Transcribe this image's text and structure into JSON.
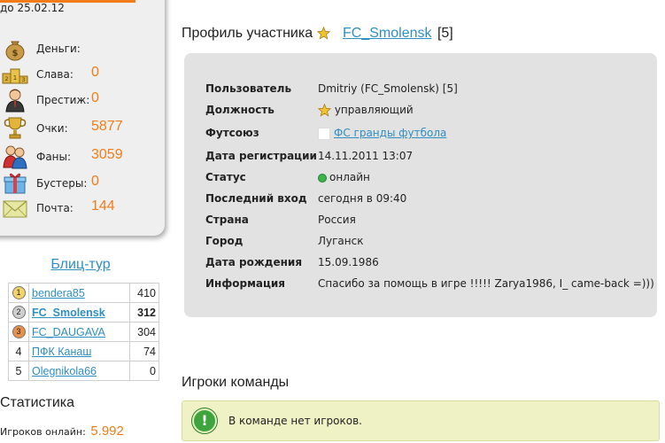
{
  "sidebar": {
    "date_until": "до 25.02.12",
    "resources": [
      {
        "label": "Деньги:",
        "value": "",
        "icon": "money-bag-icon"
      },
      {
        "label": "Слава:",
        "value": "0",
        "icon": "podium-icon"
      },
      {
        "label": "Престиж:",
        "value": "0",
        "icon": "manager-icon"
      },
      {
        "label": "Очки:",
        "value": "5877",
        "icon": "trophy-icon"
      },
      {
        "label": "Фаны:",
        "value": "3059",
        "icon": "fans-icon"
      },
      {
        "label": "Бустеры:",
        "value": "0",
        "icon": "gift-box-icon"
      },
      {
        "label": "Почта:",
        "value": "144",
        "icon": "mail-envelope-icon"
      }
    ],
    "blitz": {
      "title": "Блиц-тур",
      "rows": [
        {
          "place": "1",
          "name": "bendera85",
          "score": "410"
        },
        {
          "place": "2",
          "name": "FC_Smolensk",
          "score": "312"
        },
        {
          "place": "3",
          "name": "FC_DAUGAVA",
          "score": "304"
        },
        {
          "place": "4",
          "name": "ПФК Канаш",
          "score": "74"
        },
        {
          "place": "5",
          "name": "Olegnikola66",
          "score": "0"
        }
      ]
    },
    "stats": {
      "title": "Статистика",
      "online_label": "Игроков онлайн:",
      "online_value": "5.992"
    }
  },
  "profile": {
    "title": "Профиль участника",
    "team_link": "FC_Smolensk",
    "team_level": "[5]",
    "rows": [
      {
        "label": "Пользователь",
        "value": "Dmitriy (FC_Smolensk) [5]"
      },
      {
        "label": "Должность",
        "value": "управляющий"
      },
      {
        "label": "Футсоюз",
        "value": "ФС гранды футбола"
      },
      {
        "label": "Дата регистрации",
        "value": "14.11.2011 13:07"
      },
      {
        "label": "Статус",
        "value": "онлайн"
      },
      {
        "label": "Последний вход",
        "value": "сегодня в 09:40"
      },
      {
        "label": "Страна",
        "value": "Россия"
      },
      {
        "label": "Город",
        "value": "Луганск"
      },
      {
        "label": "Дата рождения",
        "value": "15.09.1986"
      },
      {
        "label": "Информация",
        "value": "Спасибо за помощь в игре !!!!! Zarya1986, I_ came-back =)))"
      }
    ]
  },
  "players": {
    "title": "Игроки команды",
    "notice": "В команде нет игроков."
  },
  "colors": {
    "accent_orange": "#f07d1a",
    "link_blue": "#2f8fc0",
    "card_gray": "#e2e2e2",
    "notice_bg": "#eef2c4",
    "online_green": "#39b54a"
  }
}
